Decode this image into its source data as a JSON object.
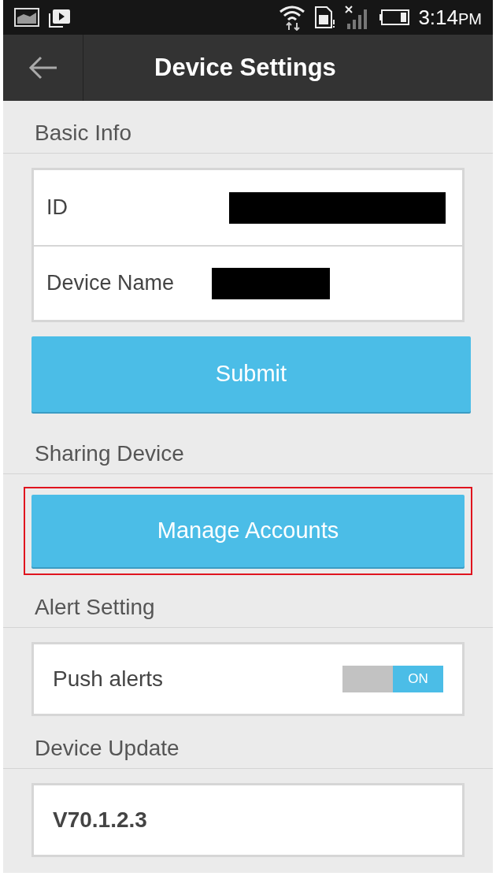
{
  "status_bar": {
    "time": "3:14",
    "ampm": "PM"
  },
  "app_bar": {
    "title": "Device Settings"
  },
  "basic_info": {
    "heading": "Basic Info",
    "fields": [
      {
        "label": "ID",
        "redacted": true
      },
      {
        "label": "Device Name",
        "redacted": true
      }
    ],
    "submit": "Submit"
  },
  "sharing": {
    "heading": "Sharing Device",
    "button": "Manage Accounts",
    "highlighted": true
  },
  "alerts": {
    "heading": "Alert Setting",
    "label": "Push alerts",
    "on": true,
    "toggle_text": "ON"
  },
  "update": {
    "heading": "Device Update",
    "version": "V70.1.2.3"
  }
}
